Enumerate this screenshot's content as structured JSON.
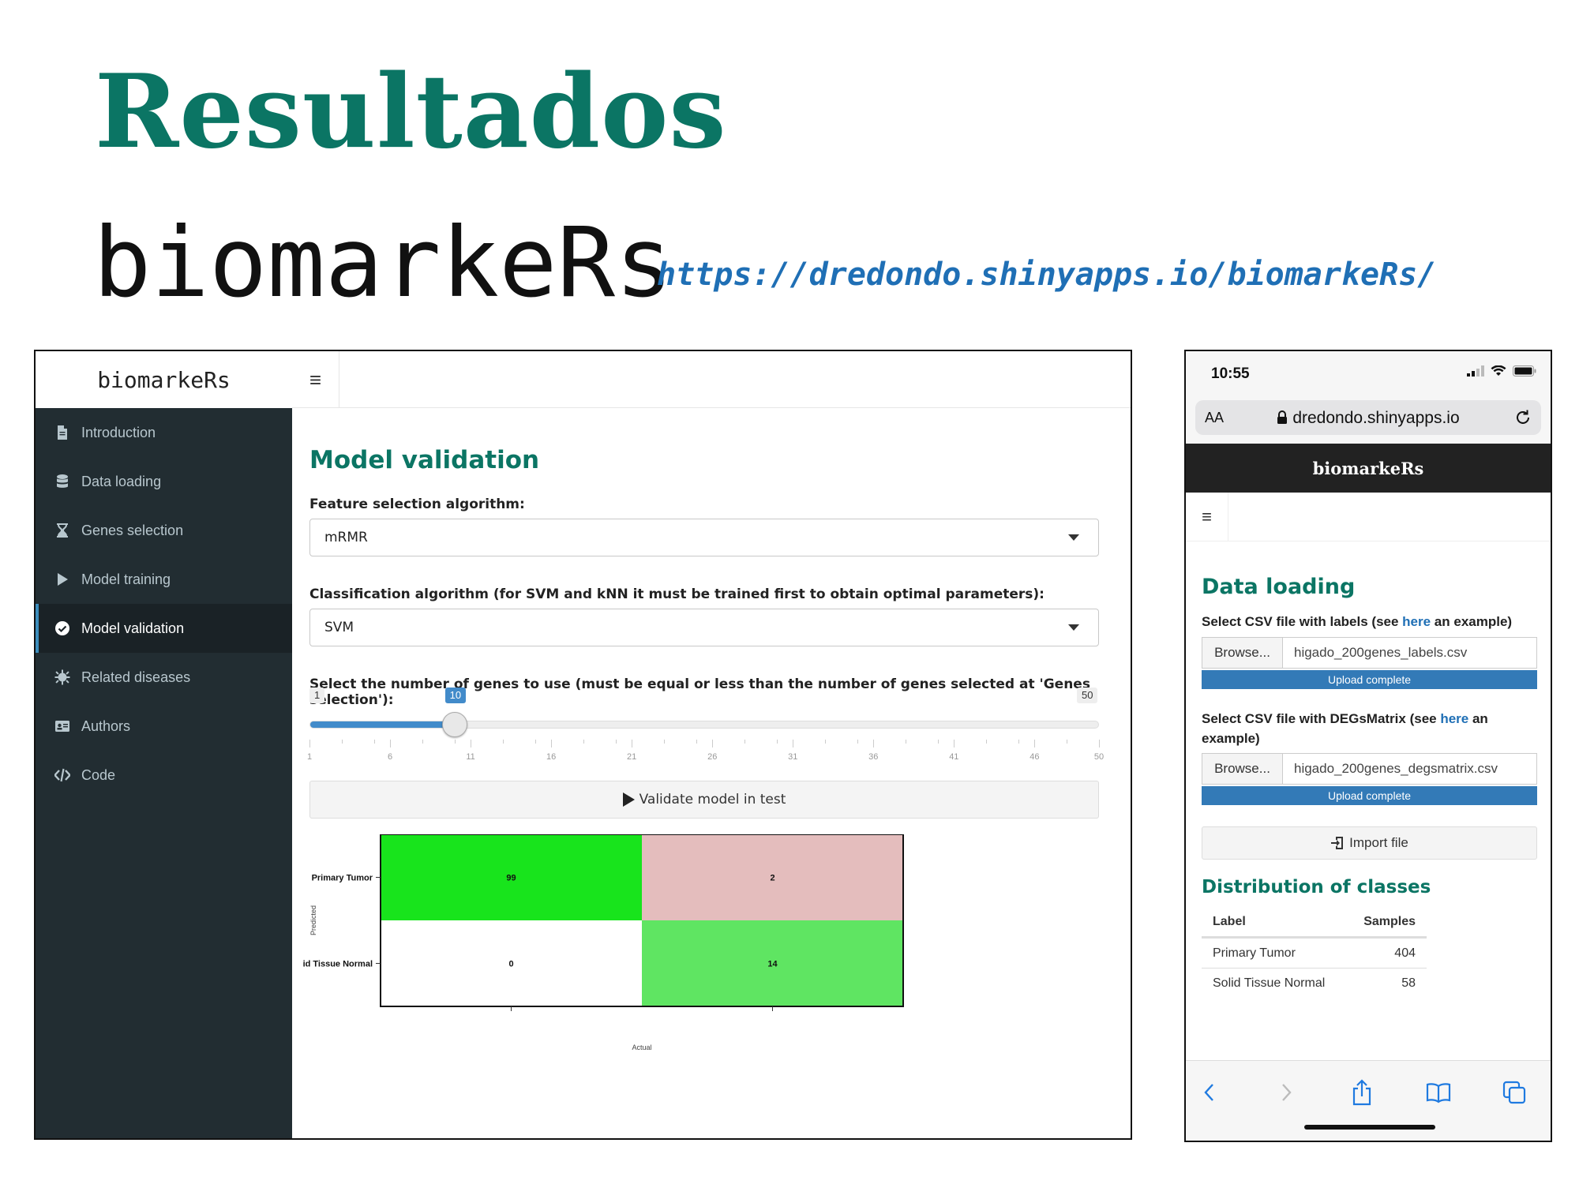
{
  "slide": {
    "title": "Resultados",
    "app_name": "biomarkeRs",
    "url": "https://dredondo.shinyapps.io/biomarkeRs/",
    "title_color": "#0b7564",
    "url_color": "#1f6fb5"
  },
  "desktop": {
    "brand": "biomarkeRs",
    "menu_icon": "≡",
    "sidebar": [
      {
        "label": "Introduction",
        "icon": "file-icon",
        "active": false
      },
      {
        "label": "Data loading",
        "icon": "database-icon",
        "active": false
      },
      {
        "label": "Genes selection",
        "icon": "hourglass-icon",
        "active": false
      },
      {
        "label": "Model training",
        "icon": "play-icon",
        "active": false
      },
      {
        "label": "Model validation",
        "icon": "check-circle-icon",
        "active": true
      },
      {
        "label": "Related diseases",
        "icon": "virus-icon",
        "active": false
      },
      {
        "label": "Authors",
        "icon": "id-card-icon",
        "active": false
      },
      {
        "label": "Code",
        "icon": "code-icon",
        "active": false
      }
    ],
    "section_title": "Model validation",
    "feature_label": "Feature selection algorithm:",
    "feature_value": "mRMR",
    "classification_label": "Classification algorithm (for SVM and kNN it must be trained first to obtain optimal parameters):",
    "classification_value": "SVM",
    "genes_label": "Select the number of genes to use (must be equal or less than the number of genes selected at 'Genes selection'):",
    "slider": {
      "min": 1,
      "max": 50,
      "value": 10,
      "min_label": "1",
      "max_label": "50",
      "value_label": "10",
      "tick_labels": [
        "1",
        "6",
        "11",
        "16",
        "21",
        "26",
        "31",
        "36",
        "41",
        "46",
        "50"
      ]
    },
    "validate_button": "Validate model in test",
    "confusion_matrix": {
      "row_labels": [
        "Primary Tumor",
        "id Tissue Normal"
      ],
      "y_axis_label": "Predicted",
      "x_axis_label": "Actual",
      "cells": [
        {
          "value": "99",
          "color": "#18e41c"
        },
        {
          "value": "2",
          "color": "#e4bdbd"
        },
        {
          "value": "0",
          "color": "#ffffff"
        },
        {
          "value": "14",
          "color": "#5fe562"
        }
      ]
    }
  },
  "phone": {
    "time": "10:55",
    "aa": "AA",
    "address": "dredondo.shinyapps.io",
    "brand": "biomarkeRs",
    "menu_icon": "≡",
    "section_title": "Data loading",
    "labels_prompt": "Select CSV file with labels (see ",
    "here": "here",
    "labels_suffix": " an example)",
    "degs_prompt": "Select CSV file with DEGsMatrix (see ",
    "degs_suffix": " an example)",
    "browse": "Browse...",
    "file1": "higado_200genes_labels.csv",
    "file2": "higado_200genes_degsmatrix.csv",
    "upload_status": "Upload complete",
    "import_button": "Import file",
    "distribution_title": "Distribution of classes",
    "table": {
      "headers": [
        "Label",
        "Samples"
      ],
      "rows": [
        [
          "Primary Tumor",
          "404"
        ],
        [
          "Solid Tissue Normal",
          "58"
        ]
      ]
    }
  }
}
